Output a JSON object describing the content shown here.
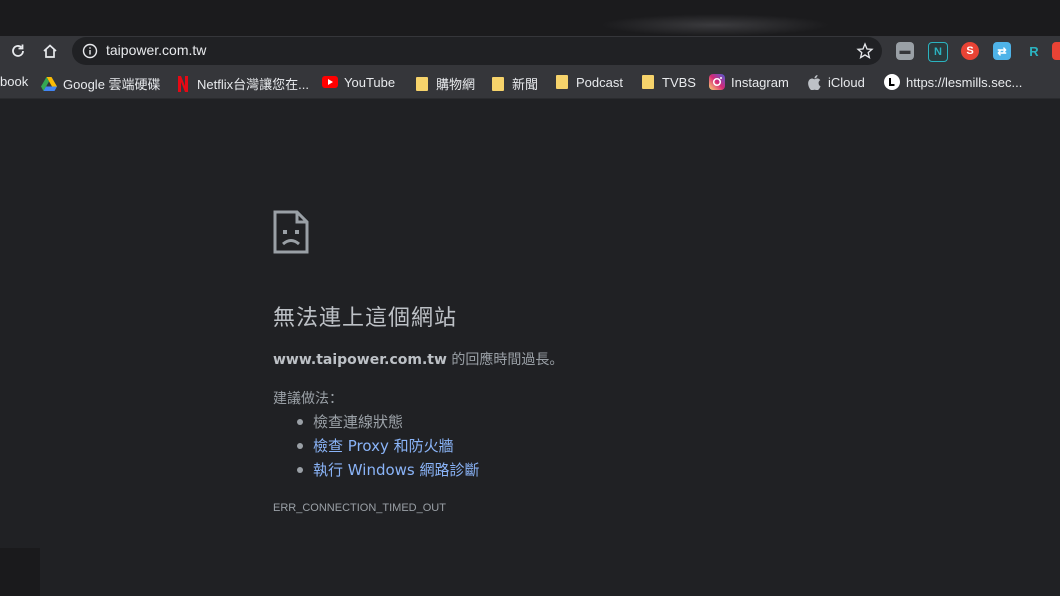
{
  "toolbar": {
    "url": "taipower.com.tw"
  },
  "bookmarks": [
    {
      "label": "book",
      "icon": "facebook-icon"
    },
    {
      "label": "Google 雲端硬碟",
      "icon": "google-drive-icon"
    },
    {
      "label": "Netflix台灣讓您在...",
      "icon": "netflix-icon"
    },
    {
      "label": "YouTube",
      "icon": "youtube-icon"
    },
    {
      "label": "購物網",
      "icon": "folder-icon"
    },
    {
      "label": "新聞",
      "icon": "folder-icon"
    },
    {
      "label": "Podcast",
      "icon": "folder-icon"
    },
    {
      "label": "TVBS",
      "icon": "folder-icon"
    },
    {
      "label": "Instagram",
      "icon": "instagram-icon"
    },
    {
      "label": "iCloud",
      "icon": "apple-icon"
    },
    {
      "label": "https://lesmills.sec...",
      "icon": "lesmills-icon"
    }
  ],
  "error": {
    "title": "無法連上這個網站",
    "host": "www.taipower.com.tw",
    "desc_suffix": " 的回應時間過長。",
    "suggest_label": "建議做法：",
    "suggestions": [
      "檢查連線狀態",
      "檢查 Proxy 和防火牆",
      "執行 Windows 網路診斷"
    ],
    "code": "ERR_CONNECTION_TIMED_OUT"
  },
  "colors": {
    "background": "#202124",
    "toolbar": "#35363a",
    "link": "#8ab4f8",
    "title_text": "#bdc1c6",
    "body_text": "#9aa0a6"
  }
}
